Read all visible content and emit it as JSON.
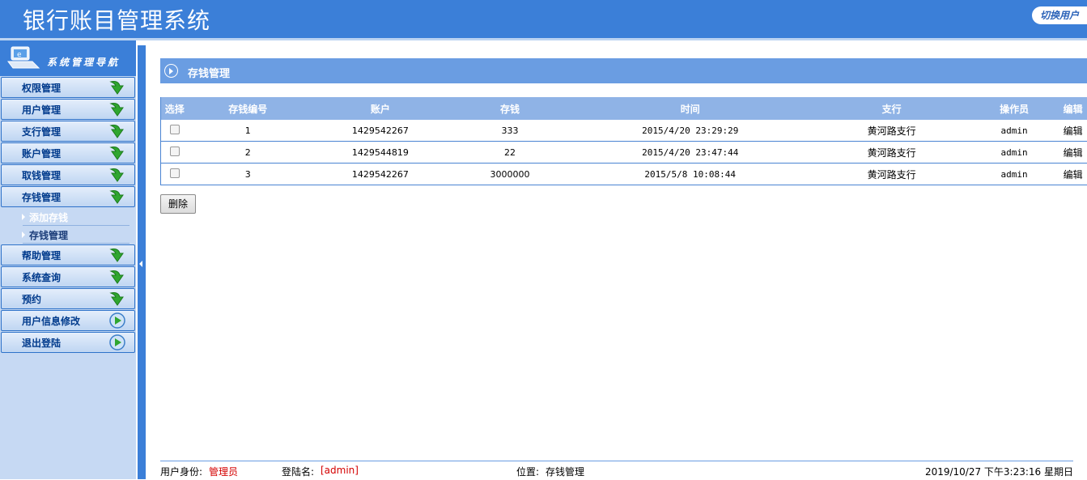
{
  "header": {
    "title": "银行账目管理系统",
    "switch_user": "切换用户"
  },
  "sidebar": {
    "nav_title": "系统管理导航",
    "items": [
      {
        "label": "权限管理",
        "icon": "green-arrow-down-icon"
      },
      {
        "label": "用户管理",
        "icon": "green-arrow-down-icon"
      },
      {
        "label": "支行管理",
        "icon": "green-arrow-down-icon"
      },
      {
        "label": "账户管理",
        "icon": "green-arrow-down-icon"
      },
      {
        "label": "取钱管理",
        "icon": "green-arrow-down-icon"
      },
      {
        "label": "存钱管理",
        "icon": "green-arrow-down-icon"
      },
      {
        "label": "帮助管理",
        "icon": "green-arrow-down-icon"
      },
      {
        "label": "系统查询",
        "icon": "green-arrow-down-icon"
      },
      {
        "label": "预约",
        "icon": "green-arrow-down-icon"
      },
      {
        "label": "用户信息修改",
        "icon": "play-circle-icon"
      },
      {
        "label": "退出登陆",
        "icon": "play-circle-icon"
      }
    ],
    "subitems": [
      {
        "label": "添加存钱"
      },
      {
        "label": "存钱管理"
      }
    ]
  },
  "main": {
    "section_title": "存钱管理",
    "columns": [
      "选择",
      "存钱编号",
      "账户",
      "存钱",
      "时间",
      "支行",
      "操作员",
      "编辑"
    ],
    "rows": [
      {
        "id": "1",
        "account": "1429542267",
        "amount": "333",
        "time": "2015/4/20 23:29:29",
        "branch": "黄河路支行",
        "operator": "admin",
        "edit": "编辑"
      },
      {
        "id": "2",
        "account": "1429544819",
        "amount": "22",
        "time": "2015/4/20 23:47:44",
        "branch": "黄河路支行",
        "operator": "admin",
        "edit": "编辑"
      },
      {
        "id": "3",
        "account": "1429542267",
        "amount": "3000000",
        "time": "2015/5/8 10:08:44",
        "branch": "黄河路支行",
        "operator": "admin",
        "edit": "编辑"
      }
    ],
    "delete_label": "删除"
  },
  "footer": {
    "role_label": "用户身份:",
    "role_value": "管理员",
    "login_label": "登陆名:",
    "login_value": "[admin]",
    "location_label": "位置:",
    "location_value": "存钱管理",
    "datetime": "2019/10/27 下午3:23:16 星期日"
  }
}
